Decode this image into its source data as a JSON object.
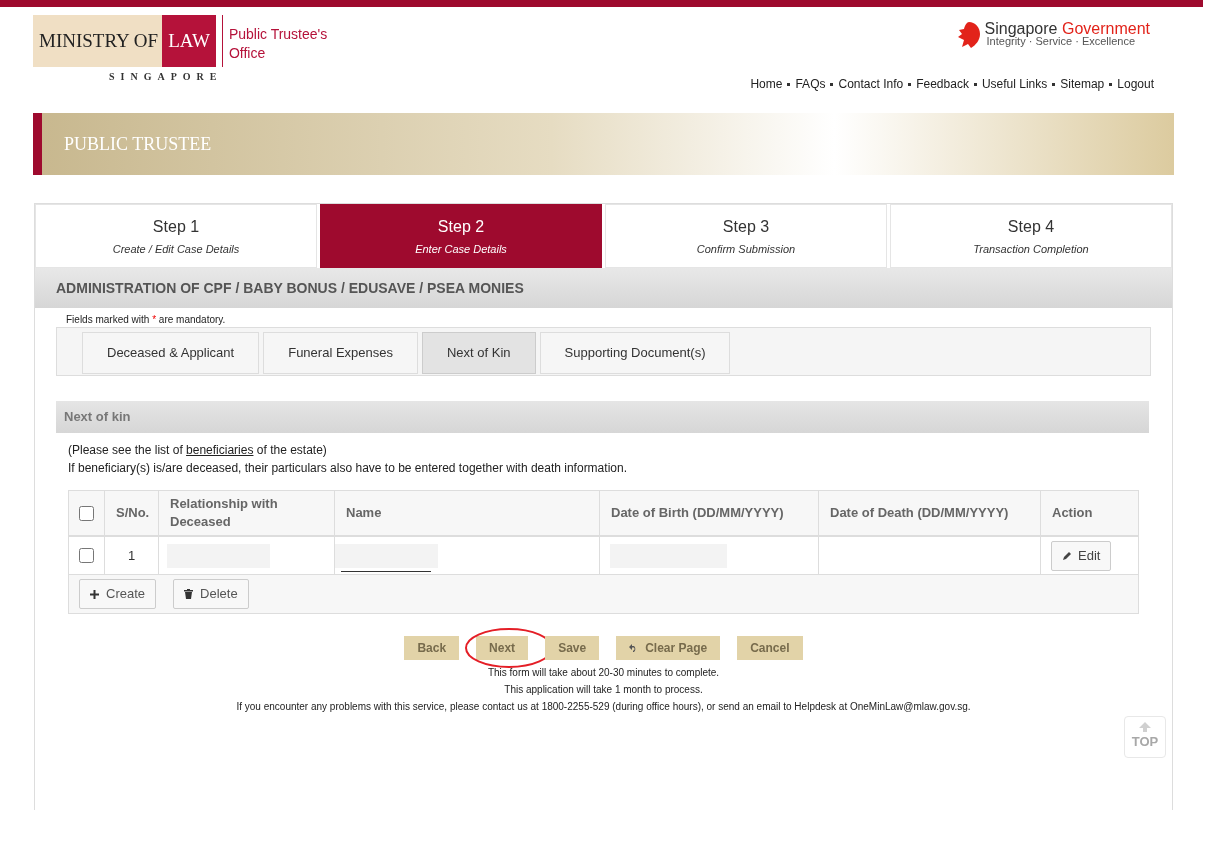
{
  "logo": {
    "ministry": "MINISTRY OF",
    "law": "LAW",
    "country": "SINGAPORE",
    "office": "Public Trustee's Office"
  },
  "gov_logo": {
    "name": "Singapore",
    "accent": "Government",
    "motto": "Integrity · Service · Excellence"
  },
  "top_nav": [
    "Home",
    "FAQs",
    "Contact Info",
    "Feedback",
    "Useful Links",
    "Sitemap",
    "Logout"
  ],
  "banner": {
    "title": "PUBLIC TRUSTEE"
  },
  "steps": [
    {
      "title": "Step 1",
      "subtitle": "Create / Edit Case Details",
      "selected": false
    },
    {
      "title": "Step 2",
      "subtitle": "Enter Case Details",
      "selected": true
    },
    {
      "title": "Step 3",
      "subtitle": "Confirm Submission",
      "selected": false
    },
    {
      "title": "Step 4",
      "subtitle": "Transaction Completion",
      "selected": false
    }
  ],
  "section_title": "ADMINISTRATION OF CPF / BABY BONUS / EDUSAVE / PSEA MONIES",
  "mandatory_note": {
    "before": "Fields marked with",
    "mark": "*",
    "after": "are mandatory."
  },
  "tabs": [
    {
      "label": "Deceased & Applicant",
      "selected": false
    },
    {
      "label": "Funeral Expenses",
      "selected": false
    },
    {
      "label": "Next of Kin",
      "selected": true
    },
    {
      "label": "Supporting Document(s)",
      "selected": false
    }
  ],
  "panel": {
    "title": "Next of kin",
    "note_before": "(Please see the list of",
    "note_link": "beneficiaries",
    "note_after": "of the estate)",
    "note2": "If beneficiary(s) is/are deceased, their particulars also have to be entered together with death information."
  },
  "table": {
    "columns": [
      "S/No.",
      "Relationship with Deceased",
      "Name",
      "Date of Birth (DD/MM/YYYY)",
      "Date of Death (DD/MM/YYYY)",
      "Action"
    ],
    "select_all_checked": false,
    "rows": [
      {
        "checked": false,
        "serial": "1",
        "relationship_hidden": true,
        "name_hidden": true,
        "dob_hidden": true,
        "action": "Edit"
      }
    ],
    "buttons": [
      {
        "kind": "create",
        "label": "Create"
      },
      {
        "kind": "delete",
        "label": "Delete"
      }
    ]
  },
  "form_buttons": [
    {
      "kind": "plain",
      "label": "Back",
      "circled": false
    },
    {
      "kind": "plain",
      "label": "Next",
      "circled": true
    },
    {
      "kind": "plain",
      "label": "Save",
      "circled": false
    },
    {
      "kind": "undo",
      "label": "Clear Page",
      "circled": false
    },
    {
      "kind": "plain",
      "label": "Cancel",
      "circled": false
    }
  ],
  "footer_notes": [
    "This form will take about 20-30 minutes to complete.",
    "This application will take 1 month to process.",
    "If you encounter any problems with this service, please contact us at 1800-2255-529 (during office hours), or send an email to Helpdesk at OneMinLaw@mlaw.gov.sg."
  ],
  "back_to_top": "TOP"
}
